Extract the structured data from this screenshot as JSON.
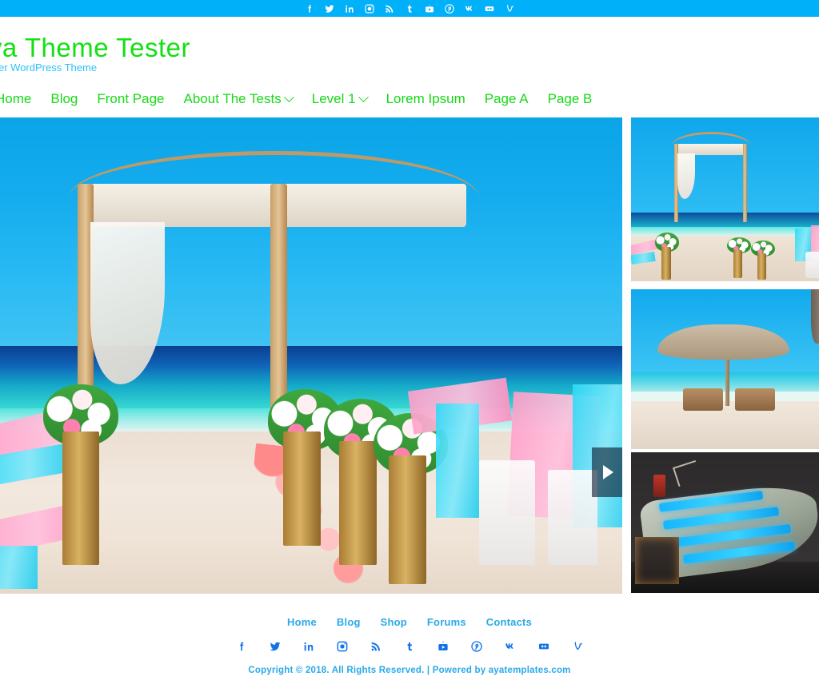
{
  "topbar": {
    "social": [
      {
        "name": "facebook-icon",
        "label": "Facebook"
      },
      {
        "name": "twitter-icon",
        "label": "Twitter"
      },
      {
        "name": "linkedin-icon",
        "label": "LinkedIn"
      },
      {
        "name": "instagram-icon",
        "label": "Instagram"
      },
      {
        "name": "rss-icon",
        "label": "RSS"
      },
      {
        "name": "tumblr-icon",
        "label": "Tumblr"
      },
      {
        "name": "youtube-icon",
        "label": "YouTube"
      },
      {
        "name": "pinterest-icon",
        "label": "Pinterest"
      },
      {
        "name": "vk-icon",
        "label": "VK"
      },
      {
        "name": "flickr-icon",
        "label": "Flickr"
      },
      {
        "name": "vine-icon",
        "label": "Vine"
      }
    ],
    "background": "#00b0f8"
  },
  "header": {
    "site_title": "Aya Theme Tester",
    "tagline": "Just another WordPress Theme",
    "title_color": "#11e011",
    "tagline_color": "#2ec2f7"
  },
  "nav": {
    "color": "#17d917",
    "items": [
      {
        "label": "Home",
        "has_dropdown": false
      },
      {
        "label": "Blog",
        "has_dropdown": false
      },
      {
        "label": "Front Page",
        "has_dropdown": false
      },
      {
        "label": "About The Tests",
        "has_dropdown": true
      },
      {
        "label": "Level 1",
        "has_dropdown": true
      },
      {
        "label": "Lorem Ipsum",
        "has_dropdown": false
      },
      {
        "label": "Page A",
        "has_dropdown": false
      },
      {
        "label": "Page B",
        "has_dropdown": false
      }
    ]
  },
  "slider": {
    "active_slide": "beach-wedding-arch",
    "next_label": "▶"
  },
  "thumbnails": [
    {
      "name": "thumb-beach-wedding",
      "alt": "Beach wedding arch with flowers"
    },
    {
      "name": "thumb-beach-umbrella",
      "alt": "Thatched beach umbrella with loungers"
    },
    {
      "name": "thumb-cruise-ship",
      "alt": "Illuminated cruise ship at night"
    }
  ],
  "footer": {
    "menu": [
      {
        "label": "Home"
      },
      {
        "label": "Blog"
      },
      {
        "label": "Shop"
      },
      {
        "label": "Forums"
      },
      {
        "label": "Contacts"
      }
    ],
    "social": [
      {
        "name": "facebook-icon",
        "label": "Facebook"
      },
      {
        "name": "twitter-icon",
        "label": "Twitter"
      },
      {
        "name": "linkedin-icon",
        "label": "LinkedIn"
      },
      {
        "name": "instagram-icon",
        "label": "Instagram"
      },
      {
        "name": "rss-icon",
        "label": "RSS"
      },
      {
        "name": "tumblr-icon",
        "label": "Tumblr"
      },
      {
        "name": "youtube-icon",
        "label": "YouTube"
      },
      {
        "name": "pinterest-icon",
        "label": "Pinterest"
      },
      {
        "name": "vk-icon",
        "label": "VK"
      },
      {
        "name": "flickr-icon",
        "label": "Flickr"
      },
      {
        "name": "vine-icon",
        "label": "Vine"
      }
    ],
    "copyright": "Copyright © 2018. All Rights Reserved. | Powered by ayatemplates.com",
    "link_color": "#2aa9e8",
    "social_color": "#1272e8"
  }
}
